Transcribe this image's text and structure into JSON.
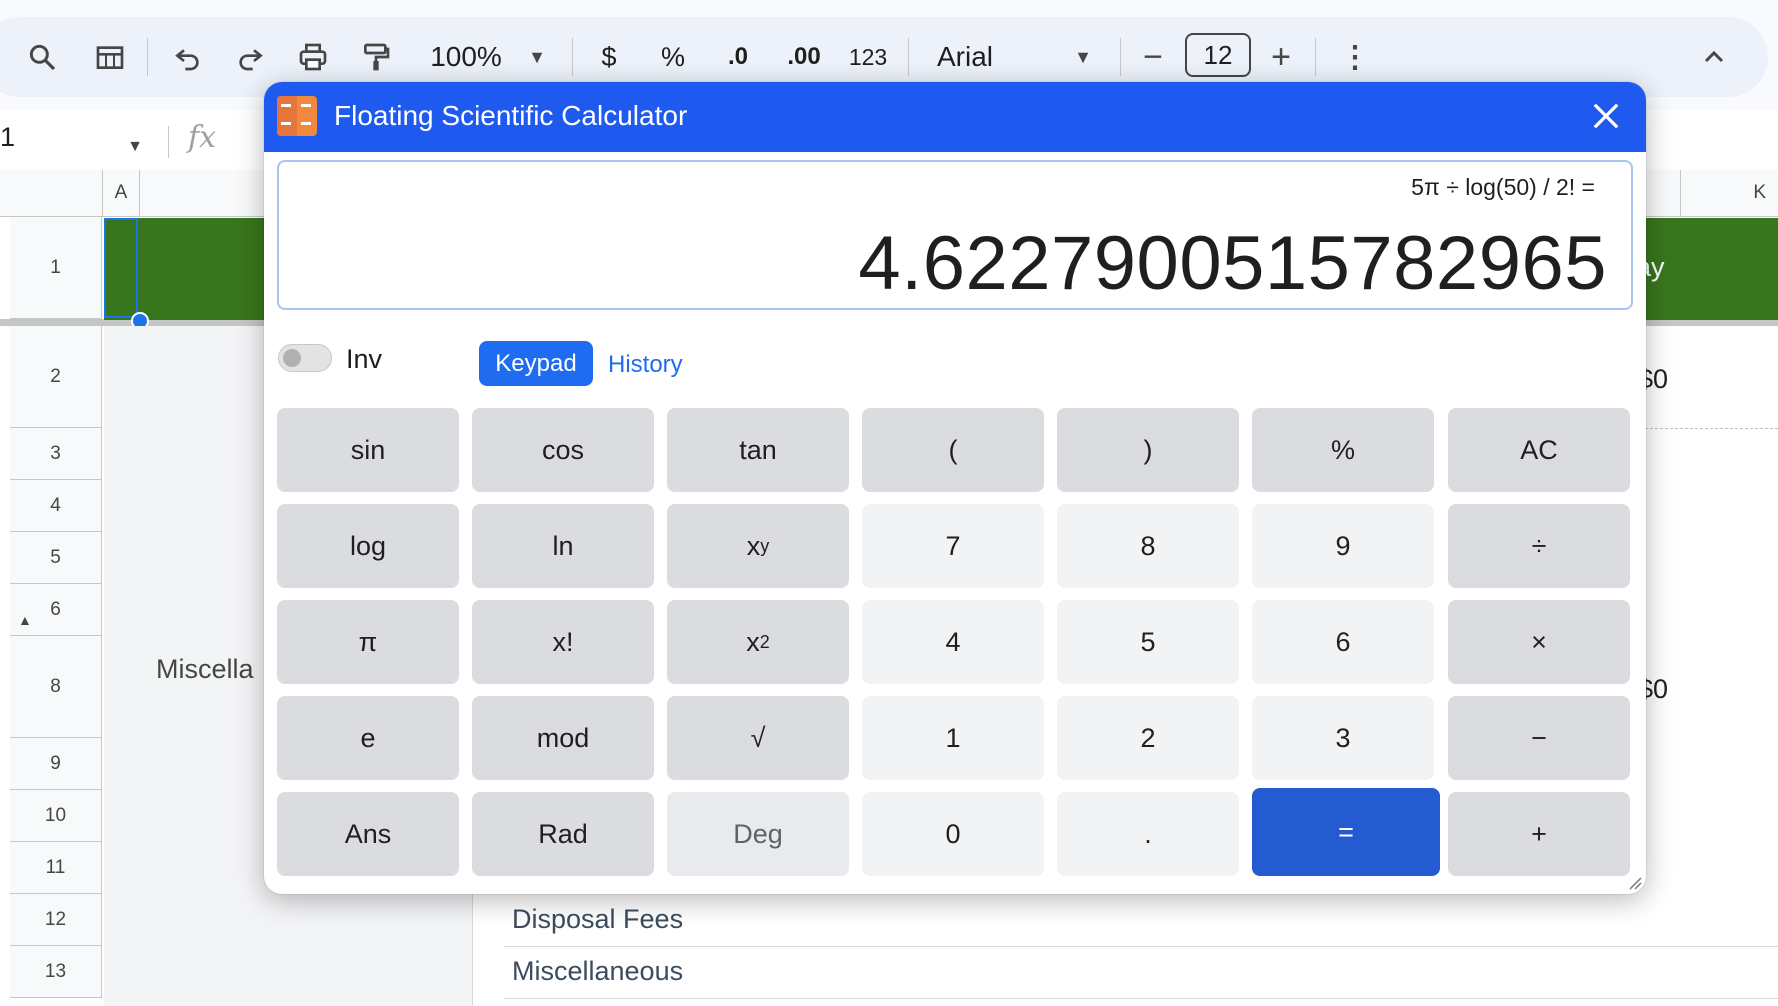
{
  "toolbar": {
    "zoom": "100%",
    "currency": "$",
    "percent": "%",
    "decrease_decimals": ".0",
    "increase_decimals": ".00",
    "number_format": "123",
    "font": "Arial",
    "font_size": "12"
  },
  "namebox": {
    "value": "1"
  },
  "grid": {
    "col_a": "A",
    "col_k": "K",
    "rows": [
      "1",
      "2",
      "3",
      "4",
      "5",
      "6",
      "8",
      "9",
      "10",
      "11",
      "12",
      "13"
    ],
    "cells": {
      "header_right": "ay",
      "amount_row2": "$0",
      "amount_row8": "$0",
      "misc_label": "Miscella",
      "disposal_fees": "Disposal Fees",
      "miscellaneous": "Miscellaneous"
    }
  },
  "calculator": {
    "title": "Floating Scientific Calculator",
    "expression": "5π ÷ log(50) / 2! =",
    "result": "4.622790051578296​5",
    "inv_label": "Inv",
    "inv_on": false,
    "tabs": {
      "keypad": "Keypad",
      "history": "History"
    },
    "keys": {
      "sin": "sin",
      "cos": "cos",
      "tan": "tan",
      "lparen": "(",
      "rparen": ")",
      "percent": "%",
      "ac": "AC",
      "log": "log",
      "ln": "ln",
      "pow_base": "x",
      "pow_exp": "y",
      "seven": "7",
      "eight": "8",
      "nine": "9",
      "divide": "÷",
      "pi": "π",
      "fact": "x!",
      "sq_base": "x",
      "sq_exp": "2",
      "four": "4",
      "five": "5",
      "six": "6",
      "multiply": "×",
      "e": "e",
      "mod": "mod",
      "sqrt": "√",
      "one": "1",
      "two": "2",
      "three": "3",
      "minus": "−",
      "ans": "Ans",
      "rad": "Rad",
      "deg": "Deg",
      "zero": "0",
      "dot": ".",
      "equals": "=",
      "plus": "+"
    },
    "colors": {
      "title_bar": "#1f5af0",
      "equals": "#255bd0",
      "accent": "#1f6cf0"
    }
  }
}
